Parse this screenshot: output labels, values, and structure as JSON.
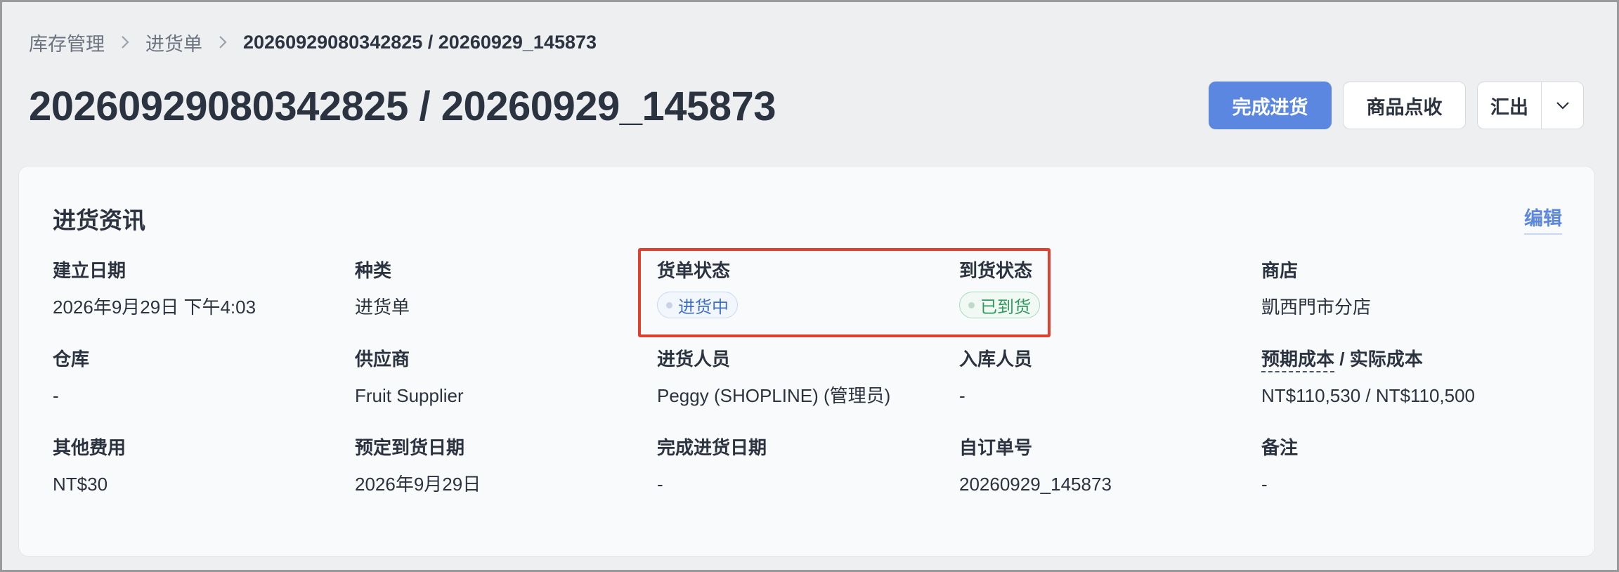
{
  "breadcrumb": {
    "items": [
      "库存管理",
      "进货单"
    ],
    "current": "20260929080342825 / 20260929_145873"
  },
  "header": {
    "title": "20260929080342825 / 20260929_145873",
    "actions": {
      "complete": "完成进货",
      "check": "商品点收",
      "export": "汇出"
    }
  },
  "card": {
    "title": "进货资讯",
    "edit": "编辑",
    "fields": {
      "created_date": {
        "label": "建立日期",
        "value": "2026年9月29日 下午4:03"
      },
      "type": {
        "label": "种类",
        "value": "进货单"
      },
      "order_status": {
        "label": "货单状态",
        "value": "进货中"
      },
      "arrival_status": {
        "label": "到货状态",
        "value": "已到货"
      },
      "store": {
        "label": "商店",
        "value": "凱西門市分店"
      },
      "warehouse": {
        "label": "仓库",
        "value": "-"
      },
      "supplier": {
        "label": "供应商",
        "value": "Fruit Supplier"
      },
      "purchaser": {
        "label": "进货人员",
        "value": "Peggy (SHOPLINE) (管理员)"
      },
      "receiver": {
        "label": "入库人员",
        "value": "-"
      },
      "cost": {
        "label_expected": "预期成本",
        "label_sep": " / ",
        "label_actual": "实际成本",
        "value": "NT$110,530 / NT$110,500"
      },
      "other_fees": {
        "label": "其他费用",
        "value": "NT$30"
      },
      "expected_arrival": {
        "label": "预定到货日期",
        "value": "2026年9月29日"
      },
      "completed_date": {
        "label": "完成进货日期",
        "value": "-"
      },
      "custom_no": {
        "label": "自订单号",
        "value": "20260929_145873"
      },
      "note": {
        "label": "备注",
        "value": "-"
      }
    }
  },
  "colors": {
    "primary": "#5b87e1",
    "highlight": "#e0412f",
    "status_blue": "#3f6fc8",
    "status_green": "#2e9a5c"
  }
}
